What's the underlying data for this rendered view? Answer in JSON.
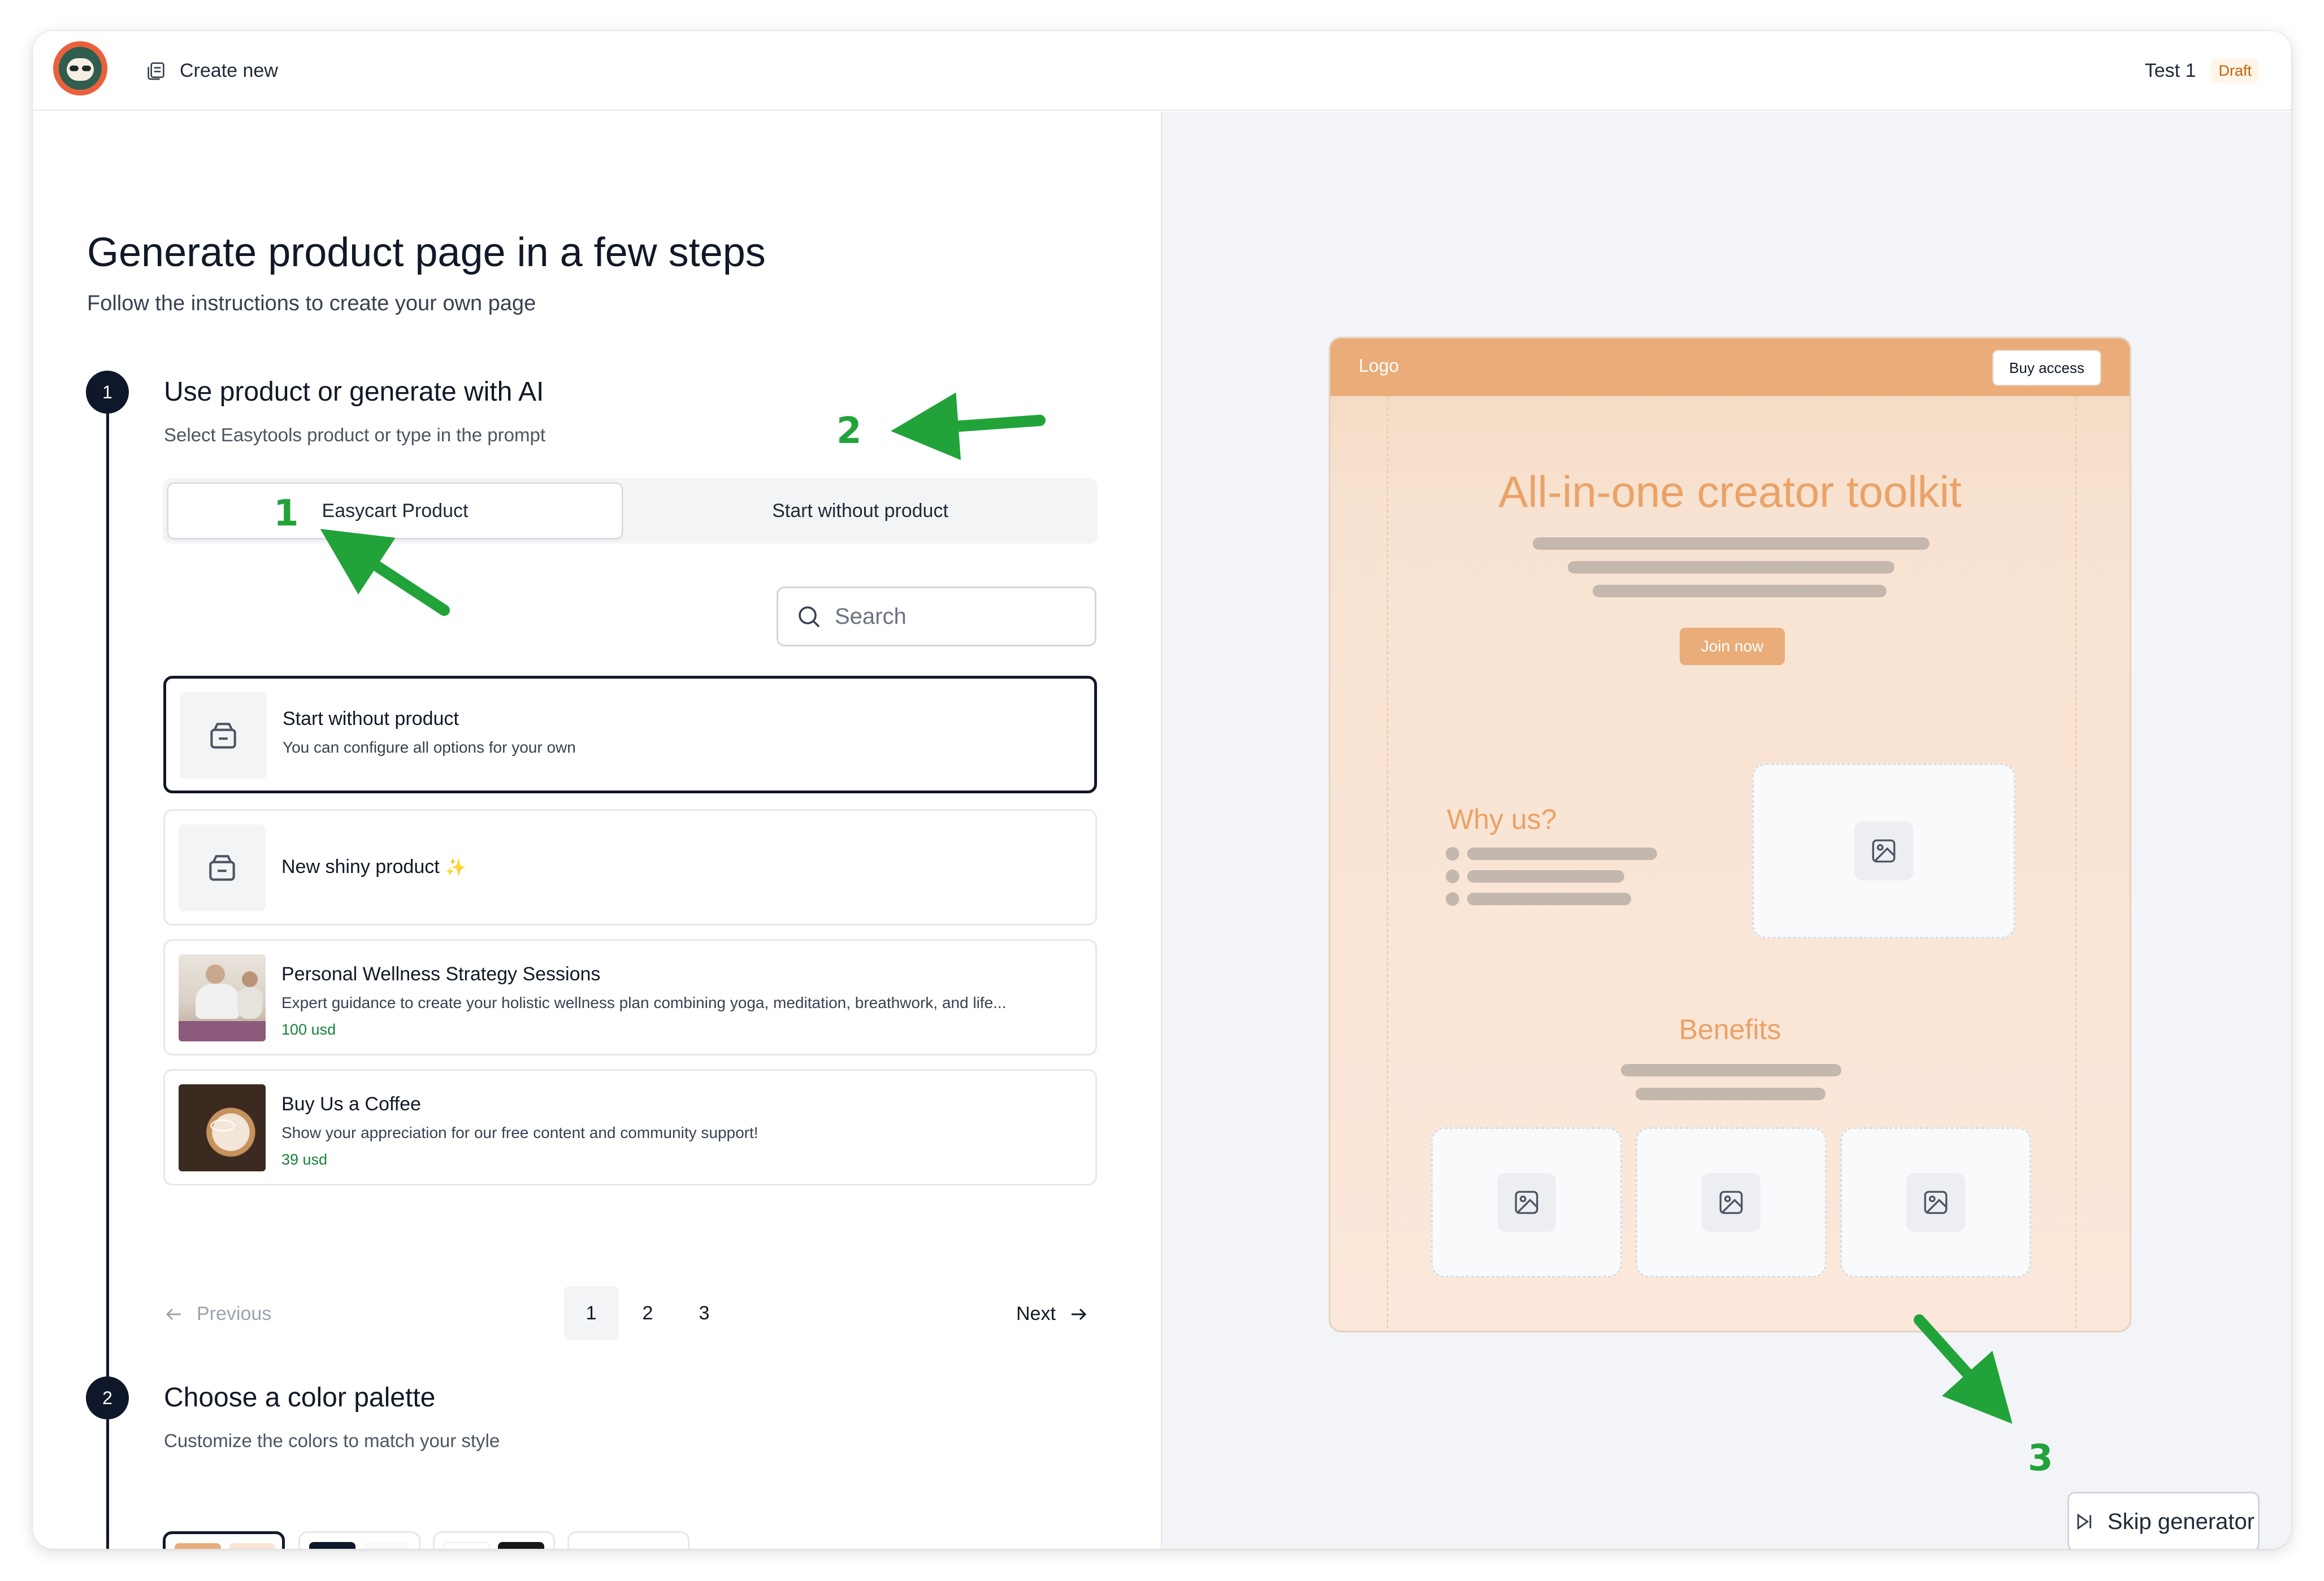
{
  "header": {
    "create_new_label": "Create new",
    "page_name": "Test 1",
    "status_badge": "Draft"
  },
  "main": {
    "title": "Generate product page in a few steps",
    "subtitle": "Follow the instructions to create your own page"
  },
  "step1": {
    "number": "1",
    "title": "Use product or generate with AI",
    "subtitle": "Select Easytools product or type in the prompt",
    "tabs": [
      {
        "label": "Easycart Product",
        "active": true
      },
      {
        "label": "Start without product",
        "active": false
      }
    ],
    "search_placeholder": "Search",
    "products": [
      {
        "title": "Start without product",
        "desc": "You can configure all options for your own",
        "price": "",
        "selected": true
      },
      {
        "title": "New shiny product",
        "desc": "",
        "price": "",
        "selected": false
      },
      {
        "title": "Personal Wellness Strategy Sessions",
        "desc": "Expert guidance to create your holistic wellness plan combining yoga, meditation, breathwork, and life...",
        "price": "100 usd",
        "selected": false
      },
      {
        "title": "Buy Us a Coffee",
        "desc": "Show your appreciation for our free content and community support!",
        "price": "39 usd",
        "selected": false
      }
    ],
    "pagination": {
      "previous": "Previous",
      "next": "Next",
      "pages": [
        "1",
        "2",
        "3"
      ],
      "current": "1"
    }
  },
  "step2": {
    "number": "2",
    "title": "Choose a color palette",
    "subtitle": "Customize the colors to match your style",
    "add_label": "+",
    "palettes": [
      {
        "colors": [
          "#eaac78",
          "#fbe5d6",
          "#ffffff",
          "#0f172a"
        ],
        "selected": true
      },
      {
        "colors": [
          "#0f172a",
          "#f8fafc",
          "#ffffff",
          "#0f172a"
        ],
        "selected": false
      },
      {
        "colors": [
          "#ffffff",
          "#171717",
          "#1f1f1f",
          "#f5f5f5"
        ],
        "selected": false
      }
    ]
  },
  "preview": {
    "logo": "Logo",
    "buy_button": "Buy access",
    "headline": "All-in-one creator toolkit",
    "join_button": "Join now",
    "why_heading": "Why us?",
    "benefits_heading": "Benefits",
    "accent_color": "#eaac78"
  },
  "skip_button": "Skip generator",
  "annotations": [
    "1",
    "2",
    "3"
  ]
}
